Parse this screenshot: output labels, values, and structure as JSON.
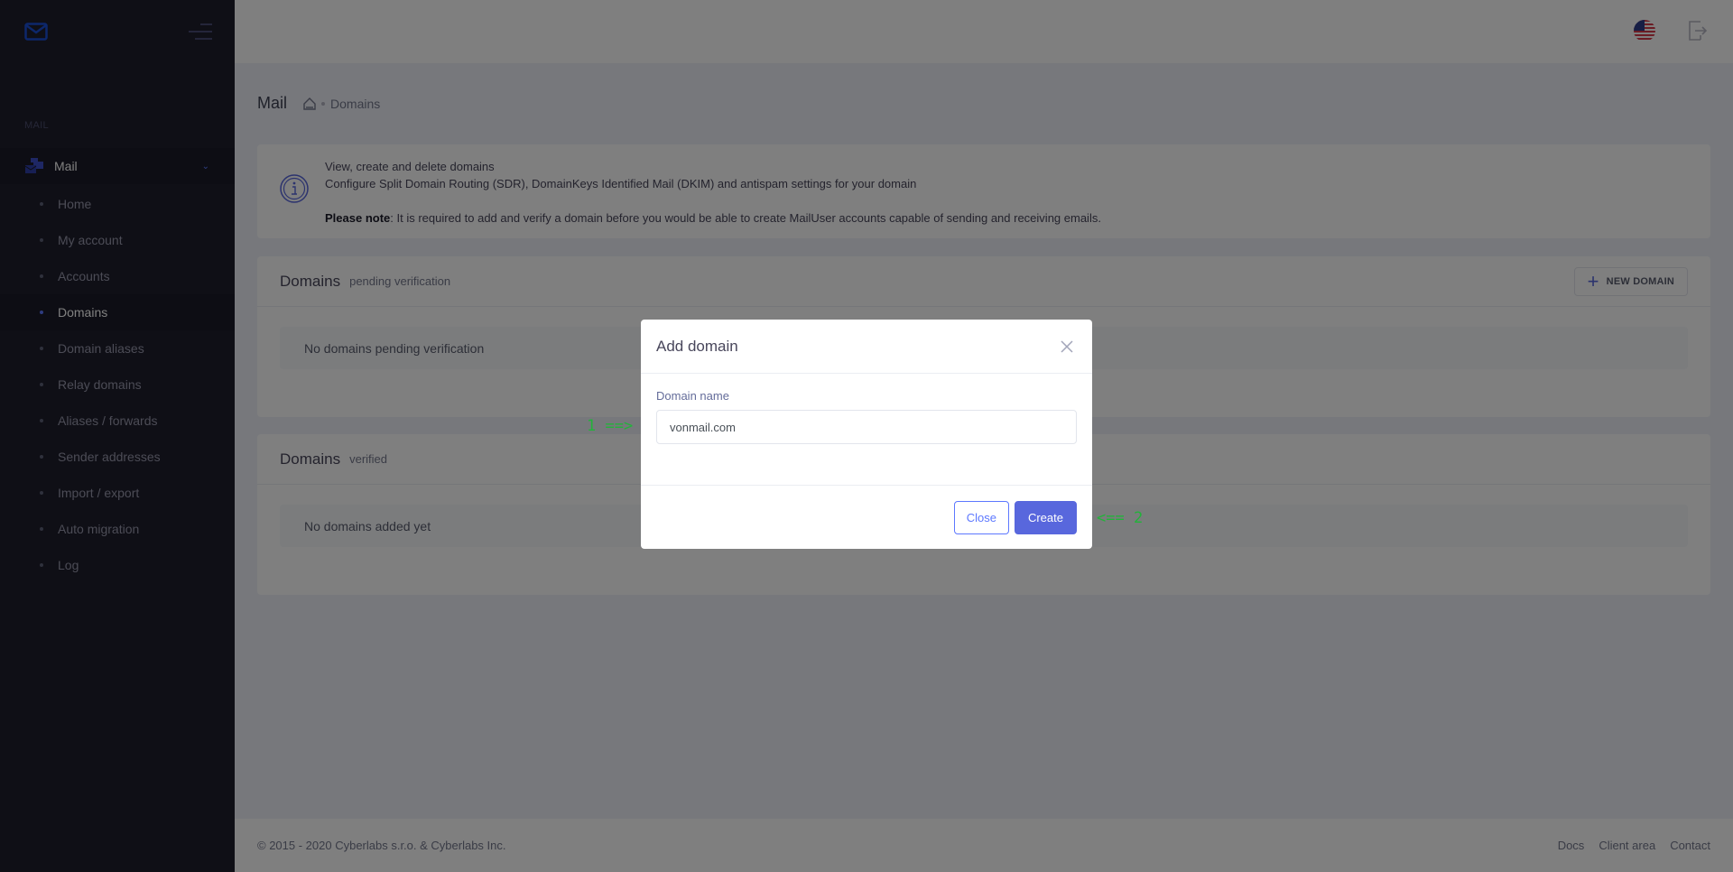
{
  "sidebar": {
    "section_label": "MAIL",
    "menu": {
      "label": "Mail",
      "expanded": true
    },
    "items": [
      {
        "label": "Home",
        "active": false
      },
      {
        "label": "My account",
        "active": false
      },
      {
        "label": "Accounts",
        "active": false
      },
      {
        "label": "Domains",
        "active": true
      },
      {
        "label": "Domain aliases",
        "active": false
      },
      {
        "label": "Relay domains",
        "active": false
      },
      {
        "label": "Aliases / forwards",
        "active": false
      },
      {
        "label": "Sender addresses",
        "active": false
      },
      {
        "label": "Import / export",
        "active": false
      },
      {
        "label": "Auto migration",
        "active": false
      },
      {
        "label": "Log",
        "active": false
      }
    ]
  },
  "header": {
    "language_icon": "us-flag-icon",
    "logout_icon": "logout-icon"
  },
  "subheader": {
    "title": "Mail",
    "breadcrumb": [
      "Domains"
    ]
  },
  "info": {
    "line1": "View, create and delete domains",
    "line2": "Configure Split Domain Routing (SDR), DomainKeys Identified Mail (DKIM) and antispam settings for your domain",
    "note_label": "Please note",
    "note_text": ": It is required to add and verify a domain before you would be able to create MailUser accounts capable of sending and receiving emails."
  },
  "pending": {
    "title": "Domains",
    "subtitle": "pending verification",
    "new_button": "NEW DOMAIN",
    "empty": "No domains pending verification"
  },
  "verified": {
    "title": "Domains",
    "subtitle": "verified",
    "empty": "No domains added yet"
  },
  "footer": {
    "copyright": "© 2015 - 2020 Cyberlabs s.r.o. & Cyberlabs Inc.",
    "links": [
      "Docs",
      "Client area",
      "Contact"
    ]
  },
  "modal": {
    "title": "Add domain",
    "field_label": "Domain name",
    "field_value": "vonmail.com",
    "close_label": "Close",
    "create_label": "Create"
  },
  "annotations": {
    "step1": "1 ==>",
    "step2": "<== 2"
  },
  "colors": {
    "accent": "#5867dd",
    "sidebar_bg": "#1e1e2d",
    "annotation": "#22b33a"
  }
}
